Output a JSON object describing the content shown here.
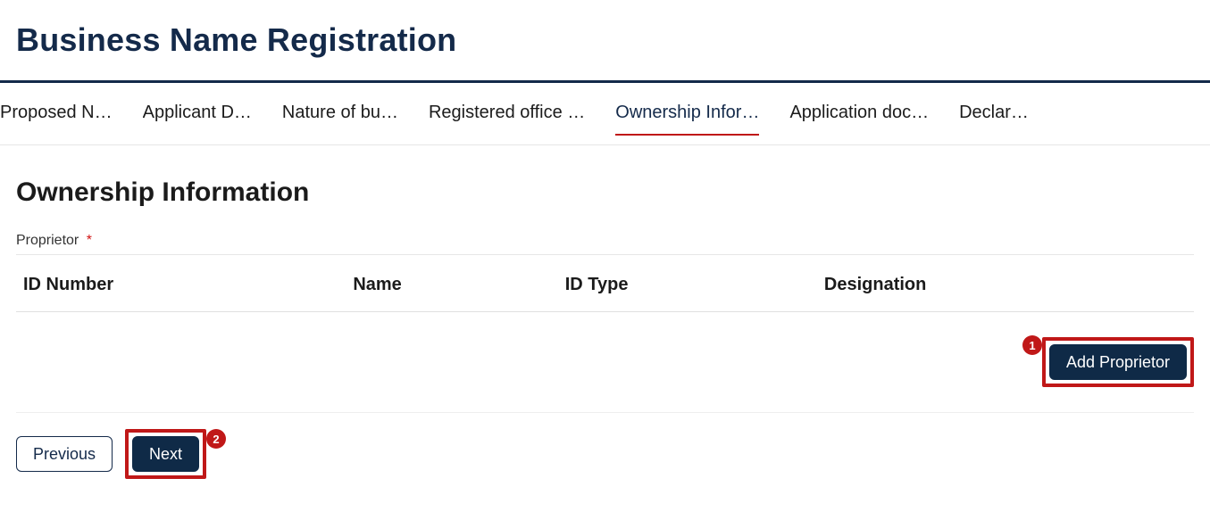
{
  "page": {
    "title": "Business Name Registration"
  },
  "tabs": {
    "items": [
      {
        "label": "Proposed N…"
      },
      {
        "label": "Applicant D…"
      },
      {
        "label": "Nature of bu…"
      },
      {
        "label": "Registered office …"
      },
      {
        "label": "Ownership Infor…"
      },
      {
        "label": "Application doc…"
      },
      {
        "label": "Declar…"
      }
    ],
    "activeIndex": 4
  },
  "section": {
    "title": "Ownership Information",
    "proprietorLabel": "Proprietor",
    "requiredMark": "*"
  },
  "table": {
    "headers": {
      "idNumber": "ID Number",
      "name": "Name",
      "idType": "ID Type",
      "designation": "Designation"
    }
  },
  "buttons": {
    "addProprietor": "Add Proprietor",
    "previous": "Previous",
    "next": "Next"
  },
  "callouts": {
    "one": "1",
    "two": "2"
  }
}
